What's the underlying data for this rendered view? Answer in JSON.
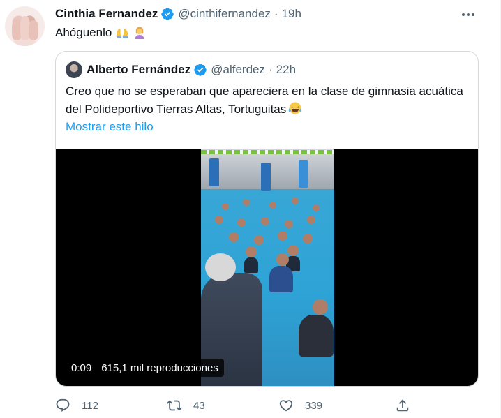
{
  "tweet": {
    "author_name": "Cinthia Fernandez",
    "author_handle": "@cinthifernandez",
    "separator": "·",
    "time": "19h",
    "text": "Ahóguenlo",
    "emoji": [
      "folded-hands-emoji",
      "woman-facepalming-emoji"
    ]
  },
  "quote": {
    "author_name": "Alberto Fernández",
    "author_handle": "@alferdez",
    "separator": "·",
    "time": "22h",
    "text": "Creo que no se esperaban que apareciera en la clase de gimnasia acuática del Polideportivo Tierras Altas, Tortuguitas",
    "emoji": "face-with-tears-of-joy-emoji",
    "show_thread": "Mostrar este hilo"
  },
  "video": {
    "elapsed": "0:09",
    "views": "615,1 mil reproducciones"
  },
  "actions": {
    "replies": "112",
    "retweets": "43",
    "likes": "339"
  },
  "colors": {
    "text": "#0f1419",
    "secondary": "#536471",
    "link": "#1d9bf0",
    "verified": "#1d9bf0",
    "border": "#cfd9de"
  }
}
